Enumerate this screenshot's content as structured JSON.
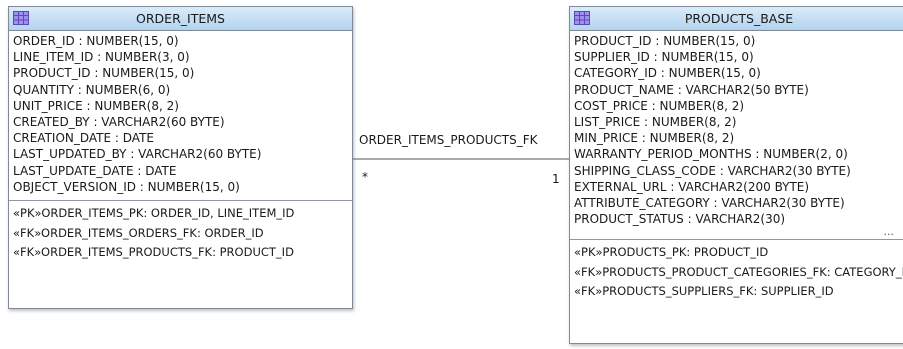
{
  "order_items": {
    "title": "ORDER_ITEMS",
    "attributes": [
      "ORDER_ID : NUMBER(15, 0)",
      "LINE_ITEM_ID : NUMBER(3, 0)",
      "PRODUCT_ID : NUMBER(15, 0)",
      "QUANTITY : NUMBER(6, 0)",
      "UNIT_PRICE : NUMBER(8, 2)",
      "CREATED_BY : VARCHAR2(60 BYTE)",
      "CREATION_DATE : DATE",
      "LAST_UPDATED_BY : VARCHAR2(60 BYTE)",
      "LAST_UPDATE_DATE : DATE",
      "OBJECT_VERSION_ID : NUMBER(15, 0)"
    ],
    "keys": [
      "«PK»ORDER_ITEMS_PK: ORDER_ID, LINE_ITEM_ID",
      "«FK»ORDER_ITEMS_ORDERS_FK: ORDER_ID",
      "«FK»ORDER_ITEMS_PRODUCTS_FK: PRODUCT_ID"
    ]
  },
  "products_base": {
    "title": "PRODUCTS_BASE",
    "attributes": [
      "PRODUCT_ID : NUMBER(15, 0)",
      "SUPPLIER_ID : NUMBER(15, 0)",
      "CATEGORY_ID : NUMBER(15, 0)",
      "PRODUCT_NAME : VARCHAR2(50 BYTE)",
      "COST_PRICE : NUMBER(8, 2)",
      "LIST_PRICE : NUMBER(8, 2)",
      "MIN_PRICE : NUMBER(8, 2)",
      "WARRANTY_PERIOD_MONTHS : NUMBER(2, 0)",
      "SHIPPING_CLASS_CODE : VARCHAR2(30 BYTE)",
      "EXTERNAL_URL : VARCHAR2(200 BYTE)",
      "ATTRIBUTE_CATEGORY : VARCHAR2(30 BYTE)",
      "PRODUCT_STATUS : VARCHAR2(30)"
    ],
    "more_indicator": "...",
    "keys": [
      "«PK»PRODUCTS_PK: PRODUCT_ID",
      "«FK»PRODUCTS_PRODUCT_CATEGORIES_FK: CATEGORY_ID",
      "«FK»PRODUCTS_SUPPLIERS_FK: SUPPLIER_ID"
    ]
  },
  "relationship": {
    "name": "ORDER_ITEMS_PRODUCTS_FK",
    "source_cardinality": "*",
    "target_cardinality": "1"
  },
  "colors": {
    "header_top": "#d9ecfb",
    "header_bottom": "#b4d3ee",
    "border": "#7f8a96",
    "icon_fill": "#9f8ff0",
    "icon_lines": "#5a4bb0"
  },
  "icons": {
    "entity": "table-grid-icon"
  }
}
